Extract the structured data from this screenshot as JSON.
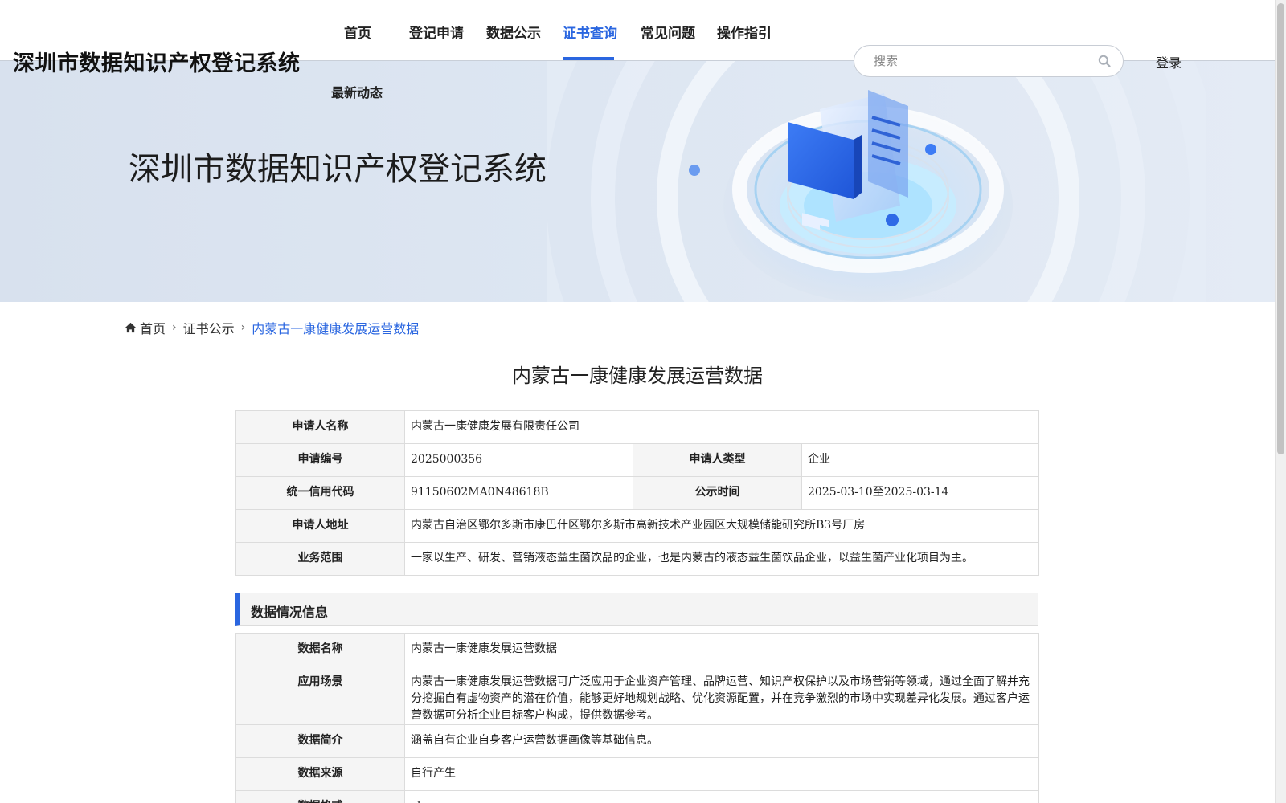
{
  "site_title": "深圳市数据知识产权登记系统",
  "nav": {
    "items": [
      {
        "label": "首页"
      },
      {
        "label": "登记申请"
      },
      {
        "label": "数据公示"
      },
      {
        "label": "证书查询"
      },
      {
        "label": "常见问题"
      },
      {
        "label": "操作指引"
      }
    ],
    "second_row": "最新动态",
    "active": "证书查询"
  },
  "search": {
    "placeholder": "搜索"
  },
  "login_label": "登录",
  "banner": {
    "title": "深圳市数据知识产权登记系统"
  },
  "breadcrumb": [
    {
      "label": "首页",
      "icon": "home-icon"
    },
    {
      "label": "证书公示"
    },
    {
      "label": "内蒙古一康健康发展运营数据"
    }
  ],
  "page_title": "内蒙古一康健康发展运营数据",
  "applicant": {
    "name_label": "申请人名称",
    "name": "内蒙古一康健康发展有限责任公司",
    "number_label": "申请编号",
    "number": "2025000356",
    "type_label": "申请人类型",
    "type": "企业",
    "credit_code_label": "统一信用代码",
    "credit_code": "91150602MA0N48618B",
    "publicity_label": "公示时间",
    "publicity_time": "2025-03-10至2025-03-14",
    "address_label": "申请人地址",
    "address": "内蒙古自治区鄂尔多斯市康巴什区鄂尔多斯市高新技术产业园区大规模储能研究所B3号厂房",
    "scope_label": "业务范围",
    "scope": "一家以生产、研发、营销液态益生菌饮品的企业，也是内蒙古的液态益生菌饮品企业，以益生菌产业化项目为主。"
  },
  "data_section": {
    "title": "数据情况信息",
    "name_label": "数据名称",
    "name": "内蒙古一康健康发展运营数据",
    "scenario_label": "应用场景",
    "scenario": "内蒙古一康健康发展运营数据可广泛应用于企业资产管理、品牌运营、知识产权保护以及市场营销等领域，通过全面了解并充分挖掘自有虚物资产的潜在价值，能够更好地规划战略、优化资源配置，并在竞争激烈的市场中实现差异化发展。通过客户运营数据可分析企业目标客户构成，提供数据参考。",
    "intro_label": "数据简介",
    "intro": "涵盖自有企业自身客户运营数据画像等基础信息。",
    "source_label": "数据来源",
    "source": "自行产生",
    "format_label": "数据格式",
    "format": "xlsx"
  },
  "colors": {
    "accent": "#2a66e0",
    "label_bg": "#f5f5f5",
    "border": "#dcdcdc"
  }
}
